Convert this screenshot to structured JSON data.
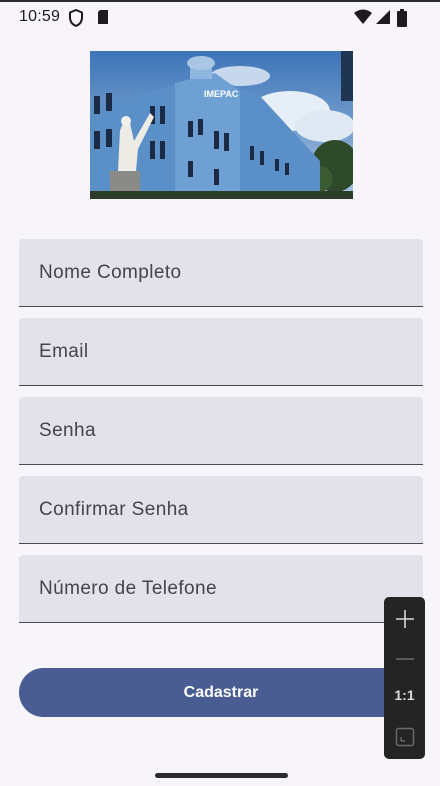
{
  "status": {
    "time": "10:59",
    "icons": [
      "shield-icon",
      "sd-card-icon",
      "wifi-icon",
      "cell-signal-icon",
      "battery-icon"
    ]
  },
  "hero": {
    "image_desc": "building-photo",
    "sign_text": "IMEPAC"
  },
  "form": {
    "fields": [
      {
        "label": "Nome Completo"
      },
      {
        "label": "Email"
      },
      {
        "label": "Senha"
      },
      {
        "label": "Confirmar Senha"
      },
      {
        "label": "Número de Telefone"
      }
    ],
    "submit_label": "Cadastrar"
  },
  "zoom": {
    "reset_label": "1:1"
  },
  "colors": {
    "primary": "#4a5d93",
    "field_bg": "#e3e2ea",
    "background": "#f7f5fa"
  }
}
